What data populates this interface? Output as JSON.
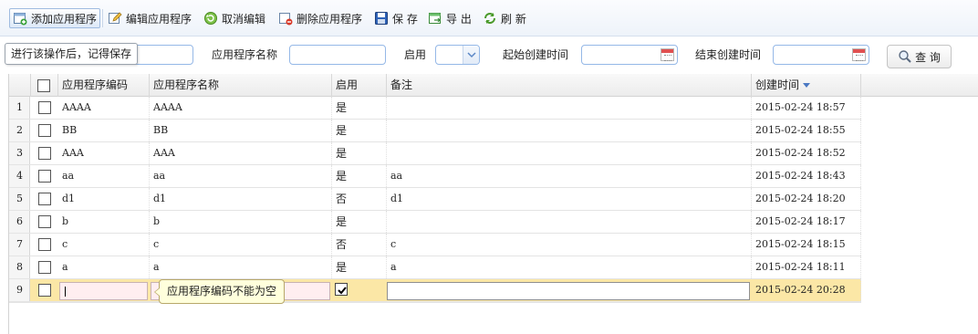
{
  "toolbar": {
    "add_label": "添加应用程序",
    "edit_label": "编辑应用程序",
    "cancel_label": "取消编辑",
    "delete_label": "删除应用程序",
    "save_label": "保 存",
    "export_label": "导 出",
    "refresh_label": "刷 新"
  },
  "tooltip": "进行该操作后，记得保存",
  "search": {
    "name_label": "应用程序名称",
    "enabled_label": "启用",
    "start_label": "起始创建时间",
    "end_label": "结束创建时间",
    "query_label": "查 询"
  },
  "columns": {
    "code": "应用程序编码",
    "name": "应用程序名称",
    "enabled": "启用",
    "remark": "备注",
    "created": "创建时间"
  },
  "rows": [
    {
      "num": "1",
      "code": "AAAA",
      "name": "AAAA",
      "enabled": "是",
      "remark": "",
      "created": "2015-02-24 18:57"
    },
    {
      "num": "2",
      "code": "BB",
      "name": "BB",
      "enabled": "是",
      "remark": "",
      "created": "2015-02-24 18:55"
    },
    {
      "num": "3",
      "code": "AAA",
      "name": "AAA",
      "enabled": "是",
      "remark": "",
      "created": "2015-02-24 18:52"
    },
    {
      "num": "4",
      "code": "aa",
      "name": "aa",
      "enabled": "是",
      "remark": "aa",
      "created": "2015-02-24 18:43"
    },
    {
      "num": "5",
      "code": "d1",
      "name": "d1",
      "enabled": "否",
      "remark": "d1",
      "created": "2015-02-24 18:20"
    },
    {
      "num": "6",
      "code": "b",
      "name": "b",
      "enabled": "是",
      "remark": "",
      "created": "2015-02-24 18:17"
    },
    {
      "num": "7",
      "code": "c",
      "name": "c",
      "enabled": "否",
      "remark": "c",
      "created": "2015-02-24 18:15"
    },
    {
      "num": "8",
      "code": "a",
      "name": "a",
      "enabled": "是",
      "remark": "a",
      "created": "2015-02-24 18:11"
    }
  ],
  "edit_row": {
    "num": "9",
    "code": "",
    "name": "",
    "enabled_checked": true,
    "remark": "",
    "created": "2015-02-24 20:28"
  },
  "validation_tip": "应用程序编码不能为空",
  "colors": {
    "edit_row_bg": "#fbe7a6",
    "input_border": "#95b8e7",
    "sort_arrow": "#4a78c2"
  }
}
